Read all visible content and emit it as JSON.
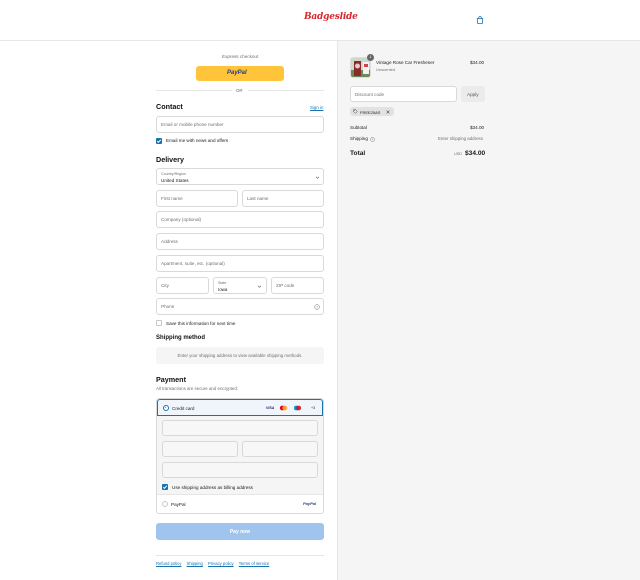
{
  "header": {
    "brand": "Badgeslide",
    "cart_icon": "bag-icon"
  },
  "express": {
    "label": "Express checkout",
    "paypal_button": "PayPal",
    "or": "OR"
  },
  "contact": {
    "title": "Contact",
    "sign_in": "Sign in",
    "email_placeholder": "Email or mobile phone number",
    "newsletter_label": "Email me with news and offers",
    "newsletter_checked": true
  },
  "delivery": {
    "title": "Delivery",
    "country_label": "Country/Region",
    "country_value": "United States",
    "first_name": "First name",
    "last_name": "Last name",
    "company": "Company (optional)",
    "address": "Address",
    "apartment": "Apartment, suite, etc. (optional)",
    "city": "City",
    "state_label": "State",
    "state_value": "Iowa",
    "zip": "ZIP code",
    "phone": "Phone",
    "save_info_label": "Save this information for next time",
    "save_info_checked": false
  },
  "shipping_method": {
    "title": "Shipping method",
    "message": "Enter your shipping address to view available shipping methods."
  },
  "payment": {
    "title": "Payment",
    "subtitle": "All transactions are secure and encrypted.",
    "credit_card_label": "Credit card",
    "card_brands": [
      "VISA",
      "mastercard",
      "maestro",
      "+3"
    ],
    "billing_same_label": "Use shipping address as billing address",
    "billing_same_checked": true,
    "paypal_label": "PayPal",
    "paypal_logo": "PayPal"
  },
  "pay_now": "Pay now",
  "footer": {
    "links": [
      "Refund policy",
      "Shipping",
      "Privacy policy",
      "Terms of service"
    ]
  },
  "summary": {
    "item": {
      "name": "Vintage Rose Car Freshener",
      "variant": "Unscented",
      "quantity": "1",
      "price": "$34.00"
    },
    "discount_placeholder": "Discount code",
    "apply": "Apply",
    "code_tag": "FREE25AS",
    "subtotal_label": "Subtotal",
    "subtotal_value": "$34.00",
    "shipping_label": "Shipping",
    "shipping_value": "Enter shipping address",
    "total_label": "Total",
    "currency": "USD",
    "total_value": "$34.00"
  },
  "colors": {
    "brand_red": "#d8262f",
    "link_blue": "#1773b0",
    "paypal_yellow": "#ffc439",
    "pay_now_disabled": "#9fc5ee"
  }
}
